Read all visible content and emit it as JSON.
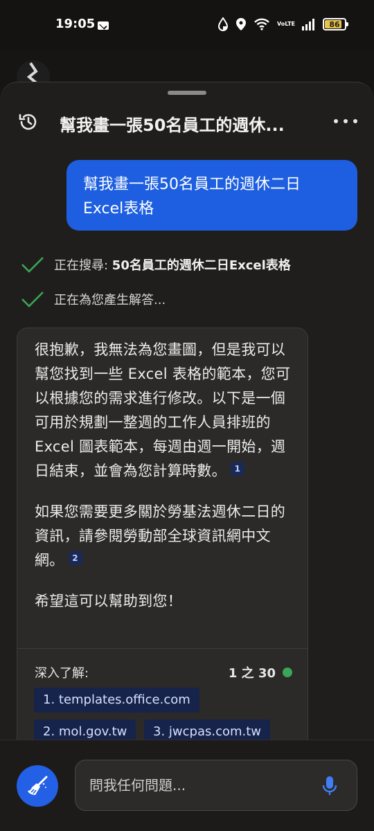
{
  "status_bar": {
    "time": "19:05",
    "battery": "86",
    "battery_level": 0.86,
    "icons": [
      "mail-icon",
      "data-saver-icon",
      "location-icon",
      "wifi-icon",
      "volte-icon",
      "signal-icon",
      "battery-icon"
    ],
    "volte_top": "Vo",
    "volte_bottom": "LTE"
  },
  "header": {
    "title": "幫我畫一張50名員工的週休..."
  },
  "user_message": {
    "text": "幫我畫一張50名員工的週休二日Excel表格"
  },
  "progress": {
    "searching_label": "正在搜尋: ",
    "searching_query": "50名員工的週休二日Excel表格",
    "generating": "正在為您產生解答..."
  },
  "answer": {
    "paragraph1": "很抱歉，我無法為您畫圖，但是我可以幫您找到一些 Excel 表格的範本，您可以根據您的需求進行修改。以下是一個可用於規劃一整週的工作人員排班的 Excel 圖表範本，每週由週一開始，週日結束，並會為您計算時數。",
    "cite1": "1",
    "paragraph2": "如果您需要更多關於勞基法週休二日的資訊，請參閱勞動部全球資訊網中文網。",
    "cite2": "2",
    "paragraph3": "希望這可以幫助到您！"
  },
  "learn_more": {
    "label": "深入了解:",
    "count": "1 之 30",
    "sources": [
      "1. templates.office.com",
      "2. mol.gov.tw",
      "3. jwcpas.com.tw"
    ]
  },
  "composer": {
    "placeholder": "問我任何問題..."
  },
  "colors": {
    "accent": "#1d5fe0",
    "check": "#3aa657",
    "background": "#1f1e1c"
  }
}
